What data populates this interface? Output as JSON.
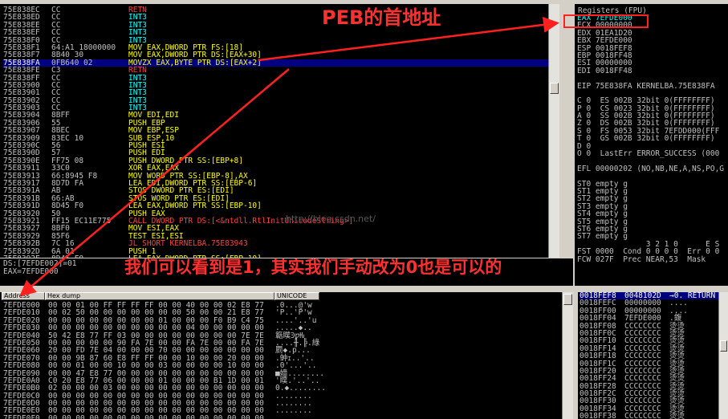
{
  "disasm": [
    {
      "addr": "75E838EC",
      "hex": "CC",
      "asm": "RETN",
      "cls": "red"
    },
    {
      "addr": "75E838ED",
      "hex": "CC",
      "asm": "INT3",
      "cls": "cyan"
    },
    {
      "addr": "75E838EE",
      "hex": "CC",
      "asm": "INT3",
      "cls": "cyan"
    },
    {
      "addr": "75E838EF",
      "hex": "CC",
      "asm": "INT3",
      "cls": "cyan"
    },
    {
      "addr": "75E838F0",
      "hex": "CC",
      "asm": "INT3",
      "cls": "cyan"
    },
    {
      "addr": "75E838F1",
      "hex": "64:A1 18000000",
      "asm": "MOV EAX,DWORD PTR FS:[18]",
      "cls": ""
    },
    {
      "addr": "75E838F7",
      "hex": "8B40 30",
      "asm": "MOV EAX,DWORD PTR DS:[EAX+30]",
      "cls": ""
    },
    {
      "addr": "75E838FA",
      "hex": "0FB640 02",
      "asm": "MOVZX EAX,BYTE PTR DS:[EAX+2]",
      "cls": "",
      "sel": true
    },
    {
      "addr": "75E838FE",
      "hex": "C3",
      "asm": "RETN",
      "cls": "red"
    },
    {
      "addr": "75E838FF",
      "hex": "CC",
      "asm": "INT3",
      "cls": "cyan"
    },
    {
      "addr": "75E83900",
      "hex": "CC",
      "asm": "INT3",
      "cls": "cyan"
    },
    {
      "addr": "75E83901",
      "hex": "CC",
      "asm": "INT3",
      "cls": "cyan"
    },
    {
      "addr": "75E83902",
      "hex": "CC",
      "asm": "INT3",
      "cls": "cyan"
    },
    {
      "addr": "75E83903",
      "hex": "CC",
      "asm": "INT3",
      "cls": "cyan"
    },
    {
      "addr": "75E83904",
      "hex": "8BFF",
      "asm": "MOV EDI,EDI",
      "cls": ""
    },
    {
      "addr": "75E83906",
      "hex": "55",
      "asm": "PUSH EBP",
      "cls": ""
    },
    {
      "addr": "75E83907",
      "hex": "8BEC",
      "asm": "MOV EBP,ESP",
      "cls": ""
    },
    {
      "addr": "75E83909",
      "hex": "83EC 10",
      "asm": "SUB ESP,10",
      "cls": ""
    },
    {
      "addr": "75E8390C",
      "hex": "56",
      "asm": "PUSH ESI",
      "cls": ""
    },
    {
      "addr": "75E8390D",
      "hex": "57",
      "asm": "PUSH EDI",
      "cls": ""
    },
    {
      "addr": "75E8390E",
      "hex": "FF75 08",
      "asm": "PUSH DWORD PTR SS:[EBP+8]",
      "cls": ""
    },
    {
      "addr": "75E83911",
      "hex": "33C0",
      "asm": "XOR EAX,EAX",
      "cls": ""
    },
    {
      "addr": "75E83913",
      "hex": "66:8945 F8",
      "asm": "MOV WORD PTR SS:[EBP-8],AX",
      "cls": ""
    },
    {
      "addr": "75E83917",
      "hex": "8D7D FA",
      "asm": "LEA EDI,DWORD PTR SS:[EBP-6]",
      "cls": ""
    },
    {
      "addr": "75E8391A",
      "hex": "AB",
      "asm": "STOS DWORD PTR ES:[EDI]",
      "cls": ""
    },
    {
      "addr": "75E8391B",
      "hex": "66:AB",
      "asm": "STOS WORD PTR ES:[EDI]",
      "cls": ""
    },
    {
      "addr": "75E8391D",
      "hex": "8D45 F0",
      "asm": "LEA EAX,DWORD PTR SS:[EBP-10]",
      "cls": ""
    },
    {
      "addr": "75E83920",
      "hex": "50",
      "asm": "PUSH EAX",
      "cls": ""
    },
    {
      "addr": "75E83921",
      "hex": "FF15 EC11E775",
      "asm": "CALL DWORD PTR DS:[<&ntdll.RtlInitUnicodeString>]",
      "cls": "red"
    },
    {
      "addr": "75E83927",
      "hex": "8BF0",
      "asm": "MOV ESI,EAX",
      "cls": ""
    },
    {
      "addr": "75E83929",
      "hex": "85F6",
      "asm": "TEST ESI,ESI",
      "cls": ""
    },
    {
      "addr": "75E8392B",
      "hex": "7C 16",
      "asm": "JL SHORT KERNELBA.75E83943",
      "cls": "red"
    },
    {
      "addr": "75E8392D",
      "hex": "6A 01",
      "asm": "PUSH 1",
      "cls": ""
    },
    {
      "addr": "75E8392F",
      "hex": "8D45 F0",
      "asm": "LEA EAX,DWORD PTR SS:[EBP-10]",
      "cls": ""
    }
  ],
  "info": {
    "line1": "DS:[7EFDE002]=01",
    "line2": "EAX=7EFDE000"
  },
  "registers": {
    "title": "Registers (FPU)",
    "lines": [
      "EAX 7EFDE000",
      "ECX 00000000",
      "EDX 01EA1D20",
      "EBX 7EFDE000",
      "ESP 0018FEF8",
      "EBP 0018FF48",
      "ESI 00000000",
      "EDI 0018FF48",
      "",
      "EIP 75E838FA KERNELBA.75E838FA",
      "",
      "C 0  ES 002B 32bit 0(FFFFFFFF)",
      "P 0  CS 0023 32bit 0(FFFFFFFF)",
      "A 0  SS 002B 32bit 0(FFFFFFFF)",
      "Z 0  DS 002B 32bit 0(FFFFFFFF)",
      "S 0  FS 0053 32bit 7EFDD000(FFF",
      "T 0  GS 002B 32bit 0(FFFFFFFF)",
      "D 0",
      "O 0  LastErr ERROR_SUCCESS (000",
      "",
      "EFL 00000202 (NO,NB,NE,A,NS,PO,G",
      "",
      "ST0 empty g",
      "ST1 empty g",
      "ST2 empty g",
      "ST3 empty g",
      "ST4 empty g",
      "ST5 empty g",
      "ST6 empty g",
      "ST7 empty g",
      "               3 2 1 0      E S",
      "FST 0000  Cond 0 0 0 0  Err 0 0",
      "FCW 027F  Prec NEAR,53  Mask"
    ]
  },
  "dump": {
    "header_address": "Address",
    "header_hex": "Hex dump",
    "header_unicode": "UNICODE",
    "rows": [
      {
        "a": "7EFDE000",
        "h": "00 00 01 00 FF FF FF FF 00 00 40 00 00 02 E8 77",
        "u": ".0...@'w"
      },
      {
        "a": "7EFDE010",
        "h": "00 02 50 00 00 00 00 00 00 00 50 00 00 21 E8 77",
        "u": "'P..'P'w"
      },
      {
        "a": "7EFDE020",
        "h": "00 00 00 00 00 00 00 00 01 00 00 00 F0 B9 C4 75",
        "u": "....'..'u"
      },
      {
        "a": "7EFDE030",
        "h": "00 00 00 00 00 00 00 00 00 00 04 00 00 00 00 00",
        "u": ".....◆.."
      },
      {
        "a": "7EFDE040",
        "h": "50 42 E8 77 FF 03 00 00 00 00 00 00 00 00 7E 7E",
        "u": "䉐瞨ϿƿǶ"
      },
      {
        "a": "7EFDE050",
        "h": "00 00 00 00 00 90 FA 7E 00 00 FA 7E 00 00 FA 7E",
        "u": "....╫.╠.綠"
      },
      {
        "a": "7EFDE060",
        "h": "20 00 FD 7E 04 00 00 00 70 00 00 00 00 00 00 00",
        "u": "︀罽◆.p..."
      },
      {
        "a": "7EFDE070",
        "h": "00 00 9B 87 60 E8 FF FF 00 00 10 00 00 20 00 00",
        "u": ".蚛ｪ..'.."
      },
      {
        "a": "7EFDE080",
        "h": "00 00 01 00 00 10 00 00 03 00 00 00 00 10 00 00",
        "u": ".0'...'.."
      },
      {
        "a": "7EFDE090",
        "h": "00 00 47 E8 77 00 00 00 00 00 00 00 00 00 00 00",
        "u": "■嬙........"
      },
      {
        "a": "7EFDE0A0",
        "h": "C0 20 E8 77 06 00 00 00 01 00 00 00 B1 1D 00 01",
        "u": "'瞨.'..'.."
      },
      {
        "a": "7EFDE0B0",
        "h": "02 00 00 00 03 00 00 00 00 00 00 00 00 00 00 00",
        "u": "0.◆........"
      },
      {
        "a": "7EFDE0C0",
        "h": "00 00 00 00 00 00 00 00 00 00 00 00 00 00 00 00",
        "u": "........"
      },
      {
        "a": "7EFDE0D0",
        "h": "00 00 00 00 00 00 00 00 00 00 00 00 00 00 00 00",
        "u": "........"
      },
      {
        "a": "7EFDE0E0",
        "h": "00 00 00 00 00 00 00 00 00 00 00 00 00 00 00 00",
        "u": "........"
      },
      {
        "a": "7EFDE0F0",
        "h": "00 00 00 00 00 00 00 00 00 00 00 00 00 00 00 00",
        "u": "........"
      }
    ]
  },
  "stack": [
    {
      "a": "0018FEF8",
      "v": "0048102D",
      "t": "→0. RETURN",
      "sel": true
    },
    {
      "a": "0018FEFC",
      "v": "00000000",
      "t": "...."
    },
    {
      "a": "0018FF00",
      "v": "00000000",
      "t": "...."
    },
    {
      "a": "0018FF04",
      "v": "7EFDE000",
      "t": ".鍑"
    },
    {
      "a": "0018FF08",
      "v": "CCCCCCCC",
      "t": "烫烫"
    },
    {
      "a": "0018FF0C",
      "v": "CCCCCCCC",
      "t": "烫烫"
    },
    {
      "a": "0018FF10",
      "v": "CCCCCCCC",
      "t": "烫烫"
    },
    {
      "a": "0018FF14",
      "v": "CCCCCCCC",
      "t": "烫烫"
    },
    {
      "a": "0018FF18",
      "v": "CCCCCCCC",
      "t": "烫烫"
    },
    {
      "a": "0018FF1C",
      "v": "CCCCCCCC",
      "t": "烫烫"
    },
    {
      "a": "0018FF20",
      "v": "CCCCCCCC",
      "t": "烫烫"
    },
    {
      "a": "0018FF24",
      "v": "CCCCCCCC",
      "t": "烫烫"
    },
    {
      "a": "0018FF28",
      "v": "CCCCCCCC",
      "t": "烫烫"
    },
    {
      "a": "0018FF2C",
      "v": "CCCCCCCC",
      "t": "烫烫"
    },
    {
      "a": "0018FF30",
      "v": "CCCCCCCC",
      "t": "烫烫"
    },
    {
      "a": "0018FF34",
      "v": "CCCCCCCC",
      "t": "烫烫"
    },
    {
      "a": "0018FF38",
      "v": "CCCCCCCC",
      "t": "烫烫"
    }
  ],
  "annotations": {
    "peb": "PEB的首地址",
    "note": "我们可以看到是1，其实我们手动改为0也是可以的",
    "watermark": "http://blog.csdn.net/"
  },
  "colors": {
    "annotation": "#ff3030",
    "selection": "#000080",
    "register_highlight": "#00ffff"
  }
}
